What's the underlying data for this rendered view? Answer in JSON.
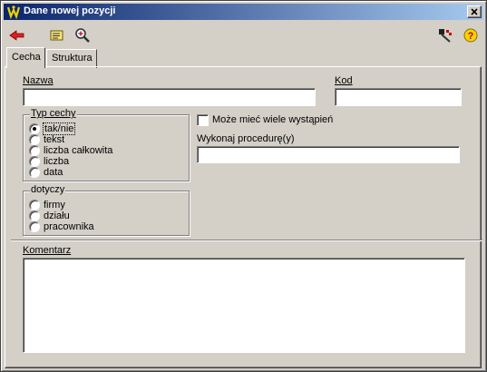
{
  "window": {
    "title": "Dane nowej pozycji",
    "close_glyph": "✕"
  },
  "toolbar": {
    "back": {
      "icon": "back-arrow-icon"
    },
    "edit": {
      "icon": "edit-card-icon"
    },
    "search": {
      "icon": "magnifier-icon"
    },
    "tool": {
      "icon": "tool-icon"
    },
    "help": {
      "icon": "help-icon",
      "glyph": "?"
    }
  },
  "tabs": [
    {
      "label": "Cecha",
      "active": true
    },
    {
      "label": "Struktura",
      "active": false
    }
  ],
  "form": {
    "nazwa": {
      "label": "Nazwa",
      "value": ""
    },
    "kod": {
      "label": "Kod",
      "value": ""
    },
    "typ_cechy": {
      "title": "Typ cechy",
      "options": [
        "tak/nie",
        "tekst",
        "liczba całkowita",
        "liczba",
        "data"
      ],
      "selected": "tak/nie"
    },
    "dotyczy": {
      "title": "dotyczy",
      "options": [
        "firmy",
        "działu",
        "pracownika"
      ],
      "selected": ""
    },
    "wiele_wystapien": {
      "label": "Może mieć wiele wystąpień",
      "checked": false
    },
    "procedura": {
      "label": "Wykonaj procedurę(y)",
      "value": ""
    },
    "komentarz": {
      "label": "Komentarz",
      "value": ""
    }
  },
  "colors": {
    "face": "#d4d0c8",
    "title_start": "#0a246a",
    "title_end": "#a6caf0",
    "back_arrow": "#e0201c",
    "help_circle": "#f5d400"
  }
}
